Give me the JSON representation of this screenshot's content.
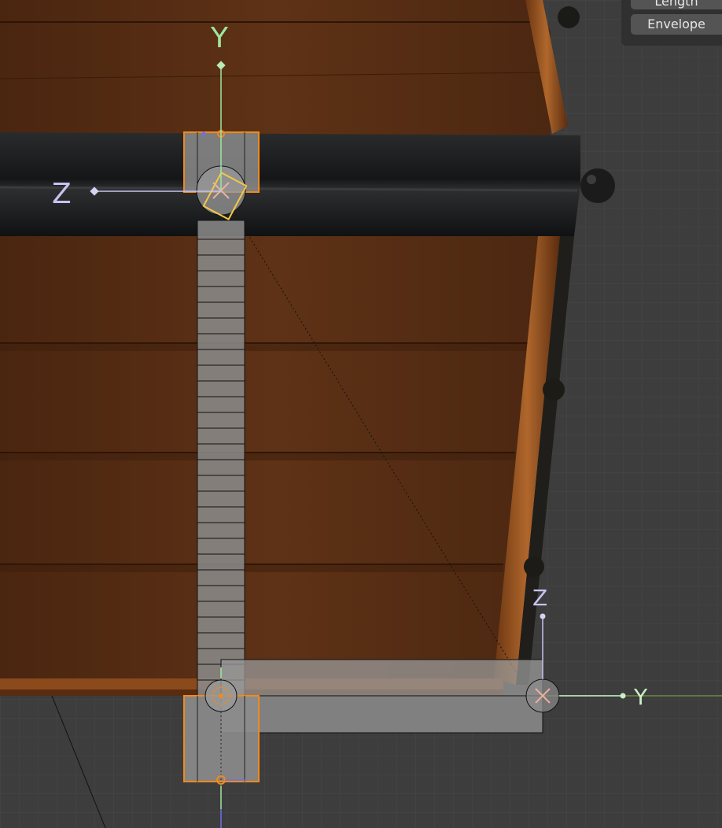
{
  "viewport": {
    "background_color": "#3d3d3d",
    "grid_color": "#474747",
    "wood_color": "#5a2f14",
    "metal_band_color": "#1e1f20",
    "rivet_trim_color": "#8a4a1c",
    "bone_fill_color": "#8c8c8c",
    "selection_color": "#f08a1c",
    "active_selection_color": "#f5c842"
  },
  "gizmo_top": {
    "y_label": "Y",
    "z_label": "Z",
    "y_color": "#9fe6a0",
    "z_color": "#c8c2f0"
  },
  "gizmo_bottom": {
    "y_label": "Y",
    "z_label": "Z",
    "y_color": "#c8f0c8",
    "z_color": "#c8c2f0"
  },
  "display_panel": {
    "length_button": "Length",
    "envelope_button": "Envelope"
  }
}
